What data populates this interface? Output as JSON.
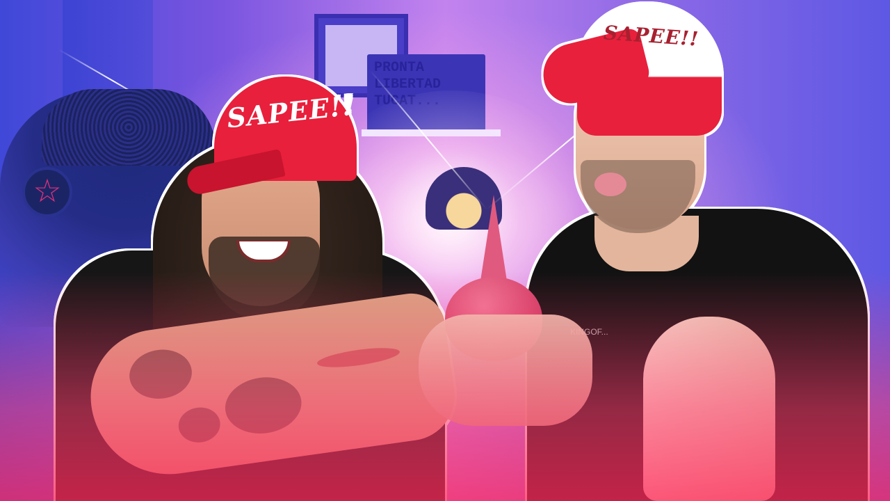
{
  "background": {
    "sign_lines": [
      "PRONTA",
      "LIBERTAD",
      "TUCAT..."
    ],
    "colors": {
      "blue": "#3f48d8",
      "purple": "#c383ee",
      "pink": "#ff3c6e"
    }
  },
  "left_person": {
    "cap_text": "SAPEE!!",
    "cap_color": "#e8203c"
  },
  "right_person": {
    "cap_text": "SAPEE!!",
    "cap_color": "#e8203c",
    "shirt_logo_text": "KINGOF..."
  },
  "object": {
    "name": "rubber-bulb-syringe",
    "color": "#d84a70"
  },
  "icons": {
    "pentacle": "pentacle-icon"
  }
}
